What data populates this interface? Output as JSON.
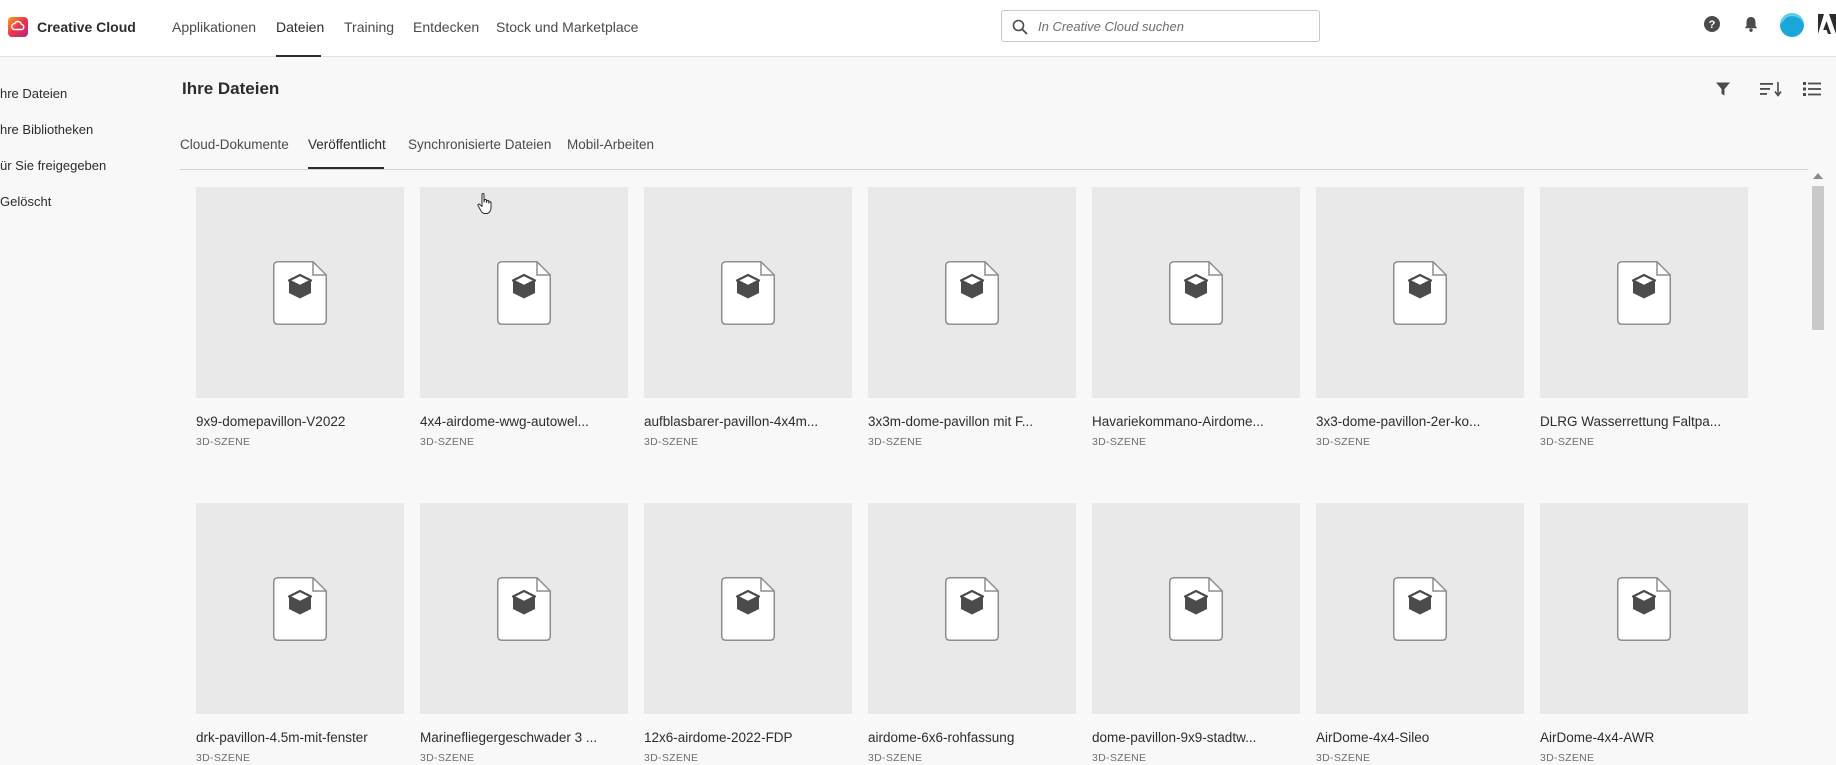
{
  "app": {
    "name": "Creative Cloud",
    "logo_icon": "creative-cloud-logo-icon",
    "accent": "#e9344d"
  },
  "nav": {
    "items": [
      {
        "label": "Applikationen",
        "active": false
      },
      {
        "label": "Dateien",
        "active": true
      },
      {
        "label": "Training",
        "active": false
      },
      {
        "label": "Entdecken",
        "active": false
      },
      {
        "label": "Stock und Marketplace",
        "active": false
      }
    ]
  },
  "search": {
    "placeholder": "In Creative Cloud suchen",
    "value": "",
    "icon": "search-icon"
  },
  "topbar_icons": [
    "help-icon",
    "bell-icon",
    "avatar",
    "adobe-logo-icon"
  ],
  "sidebar": {
    "items": [
      {
        "label": "hre Dateien"
      },
      {
        "label": "hre Bibliotheken"
      },
      {
        "label": "ür Sie freigegeben"
      },
      {
        "label": "Gelöscht"
      }
    ]
  },
  "header": {
    "title": "Ihre Dateien",
    "tools": [
      "filter-icon",
      "sort-icon",
      "list-view-icon"
    ]
  },
  "tabs": [
    {
      "label": "Cloud-Dokumente",
      "active": false
    },
    {
      "label": "Veröffentlicht",
      "active": true
    },
    {
      "label": "Synchronisierte Dateien",
      "active": false
    },
    {
      "label": "Mobil-Arbeiten",
      "active": false
    }
  ],
  "files": [
    {
      "name": "9x9-domepavillon-V2022",
      "type": "3D-SZENE"
    },
    {
      "name": "4x4-airdome-wwg-autowel...",
      "type": "3D-SZENE"
    },
    {
      "name": "aufblasbarer-pavillon-4x4m...",
      "type": "3D-SZENE"
    },
    {
      "name": "3x3m-dome-pavillon mit F...",
      "type": "3D-SZENE"
    },
    {
      "name": "Havariekommano-Airdome...",
      "type": "3D-SZENE"
    },
    {
      "name": "3x3-dome-pavillon-2er-ko...",
      "type": "3D-SZENE"
    },
    {
      "name": "DLRG Wasserrettung Faltpa...",
      "type": "3D-SZENE"
    },
    {
      "name": "drk-pavillon-4.5m-mit-fenster",
      "type": "3D-SZENE"
    },
    {
      "name": "Marinefliegergeschwader 3 ...",
      "type": "3D-SZENE"
    },
    {
      "name": "12x6-airdome-2022-FDP",
      "type": "3D-SZENE"
    },
    {
      "name": "airdome-6x6-rohfassung",
      "type": "3D-SZENE"
    },
    {
      "name": "dome-pavillon-9x9-stadtw...",
      "type": "3D-SZENE"
    },
    {
      "name": "AirDome-4x4-Sileo",
      "type": "3D-SZENE"
    },
    {
      "name": "AirDome-4x4-AWR",
      "type": "3D-SZENE"
    }
  ],
  "file_icon": "3d-file-icon"
}
